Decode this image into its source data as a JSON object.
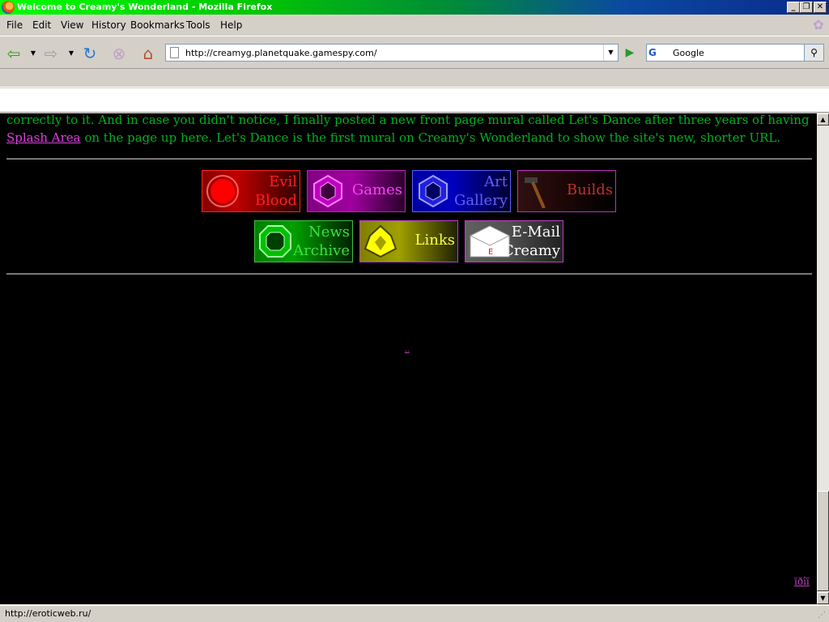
{
  "window": {
    "title": "Welcome to Creamy's Wonderland - Mozilla Firefox",
    "buttons": [
      "_",
      "❐",
      "✕"
    ]
  },
  "menu": {
    "items": [
      {
        "label": "File",
        "accel": "F"
      },
      {
        "label": "Edit",
        "accel": "E"
      },
      {
        "label": "View",
        "accel": "V"
      },
      {
        "label": "History",
        "accel": "s"
      },
      {
        "label": "Bookmarks",
        "accel": "B"
      },
      {
        "label": "Tools",
        "accel": "T"
      },
      {
        "label": "Help",
        "accel": "H"
      }
    ]
  },
  "navbar": {
    "url": "http://creamyg.planetquake.gamespy.com/",
    "search_engine": "G",
    "search_text": "Google"
  },
  "content": {
    "paragraph_before": "correctly to it. And in case you didn't notice, I finally posted a new front page mural called Let's Dance after three years of having ",
    "paragraph_link": "Splash Area",
    "paragraph_after": " on the page up here. Let's Dance is the first mural on Creamy's Wonderland to show the site's new, shorter URL.",
    "tiles": [
      {
        "label": "Evil\nBlood",
        "icon": "red-orb-icon",
        "color": "#ff2020"
      },
      {
        "label": "Games",
        "icon": "purple-gem-icon",
        "color": "#ff40ff"
      },
      {
        "label": "Art\nGallery",
        "icon": "blue-gem-icon",
        "color": "#6060ff"
      },
      {
        "label": "Builds",
        "icon": "hammer-icon",
        "color": "#c03030"
      },
      {
        "label": "News\nArchive",
        "icon": "green-gem-icon",
        "color": "#40e040"
      },
      {
        "label": "Links",
        "icon": "yellow-gem-icon",
        "color": "#ffff40"
      },
      {
        "label": "E-Mail\nCreamy",
        "icon": "envelope-icon",
        "color": "#ffffff"
      }
    ],
    "tiny_link": "..",
    "corner_link": "ïðîï"
  },
  "status": {
    "text": "http://eroticweb.ru/"
  },
  "colors": {
    "body_text": "#00b020",
    "link": "#e040e0",
    "background": "#000000"
  }
}
